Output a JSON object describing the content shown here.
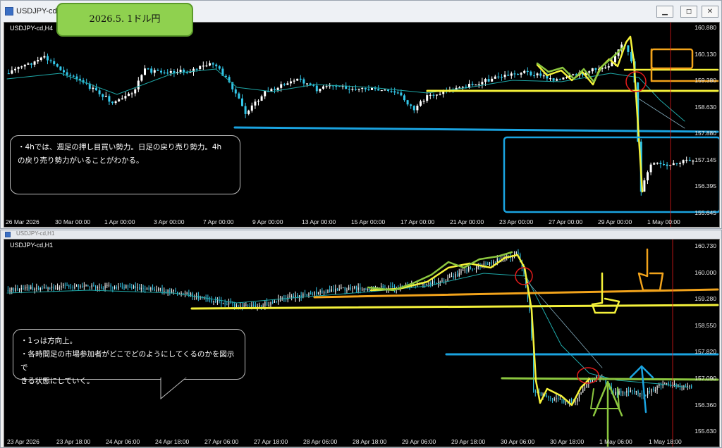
{
  "badge": {
    "text": "2026.5. 1ドル円"
  },
  "top": {
    "window_title": "USDJPY-cd,H4",
    "symbol": "USDJPY-cd,H4",
    "price_labels": [
      "160.880",
      "160.130",
      "159.380",
      "158.630",
      "157.880",
      "157.145",
      "156.395",
      "155.645"
    ],
    "time_labels": [
      "26 Mar 2026",
      "30 Mar 00:00",
      "1 Apr 00:00",
      "3 Apr 00:00",
      "7 Apr 00:00",
      "9 Apr 00:00",
      "13 Apr 00:00",
      "15 Apr 00:00",
      "17 Apr 00:00",
      "21 Apr 00:00",
      "23 Apr 00:00",
      "27 Apr 00:00",
      "29 Apr 00:00",
      "1 May 00:00"
    ],
    "note_line1": "・4hでは、週足の押し目買い勢力。日足の戻り売り勢力。4h",
    "note_line2": "の戻り売り勢力がいることがわかる。"
  },
  "bottom": {
    "window_title": "USDJPY-cd,H1",
    "symbol": "USDJPY-cd,H1",
    "price_labels": [
      "160.730",
      "160.000",
      "159.280",
      "158.550",
      "157.820",
      "157.090",
      "156.360",
      "155.630"
    ],
    "time_labels": [
      "23 Apr 2026",
      "23 Apr 18:00",
      "24 Apr 06:00",
      "24 Apr 18:00",
      "27 Apr 06:00",
      "27 Apr 18:00",
      "28 Apr 06:00",
      "28 Apr 18:00",
      "29 Apr 06:00",
      "29 Apr 18:00",
      "30 Apr 06:00",
      "30 Apr 18:00",
      "1 May 06:00",
      "1 May 18:00"
    ],
    "note_line1": "・1っは方向上。",
    "note_line2": "・各時間足の市場参加者がどこでどのようにしてくるのかを図示で",
    "note_line3": "きる状態にしていく。"
  },
  "controls": {
    "minimize": "▁",
    "restore": "◻",
    "close": "✕"
  },
  "colors": {
    "bull": "#ffffff",
    "bear": "#33c6e8",
    "ma": "#1ea7a7",
    "yellow": "#f4f13a",
    "orange": "#f2a31b",
    "blue": "#1aa3e0",
    "green": "#8bc63f",
    "red": "#e21b1b"
  }
}
